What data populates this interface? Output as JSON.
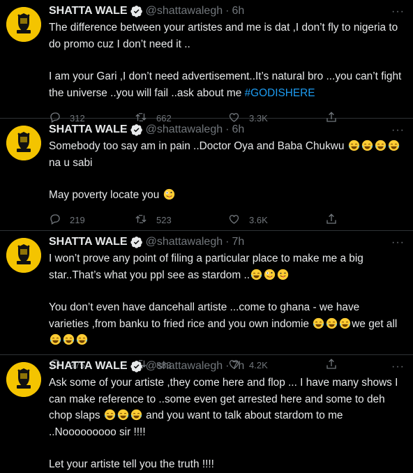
{
  "colors": {
    "background": "#000000",
    "text": "#e7e9ea",
    "muted": "#71767b",
    "link": "#1d9bf0",
    "verified": "#e7e9ea",
    "avatar": "#f4c400"
  },
  "tweets": [
    {
      "name": "SHATTA WALE",
      "handle": "@shattawalegh",
      "time": "6h",
      "paragraphs": [
        {
          "text": "The difference between your artistes and me is dat ,I don’t fly to nigeria to do promo cuz I don’t need it .."
        },
        {
          "text": "I am your Gari ,I don’t need advertisement..It’s natural bro ...you can’t fight the universe ..you will fail ..ask about me ",
          "hashtag": "#GODISHERE"
        }
      ],
      "stats": {
        "replies": "312",
        "retweets": "662",
        "likes": "3.3K"
      }
    },
    {
      "name": "SHATTA WALE",
      "handle": "@shattawalegh",
      "time": "6h",
      "paragraphs": [
        {
          "text": "Somebody too say am in pain ..Doctor Oya and Baba Chukwu",
          "emojis_after": [
            "tears-of-joy",
            "tears-of-joy",
            "tears-of-joy",
            "tears-of-joy"
          ],
          "text2": " na u sabi"
        },
        {
          "text": "May poverty locate  you",
          "emojis_after": [
            "zany-face"
          ]
        }
      ],
      "stats": {
        "replies": "219",
        "retweets": "523",
        "likes": "3.6K"
      }
    },
    {
      "name": "SHATTA WALE",
      "handle": "@shattawalegh",
      "time": "7h",
      "paragraphs": [
        {
          "text": "I won’t prove any point of filing a particular place to make me a big star..That’s what you ppl see as stardom ..",
          "emojis_after": [
            "tears-of-joy",
            "zany-face",
            "winking-tongue-face"
          ]
        },
        {
          "text": "You don’t even have dancehall artiste ...come to ghana - we have varieties ,from banku to fried rice and you own indomie",
          "emojis_after": [
            "tears-of-joy",
            "tears-of-joy",
            "tears-of-joy"
          ],
          "text2": "we get all",
          "emojis_after2": [
            "tears-of-joy",
            "tears-of-joy",
            "tears-of-joy"
          ]
        }
      ],
      "stats": {
        "replies": "375",
        "retweets": "883",
        "likes": "4.2K"
      }
    },
    {
      "name": "SHATTA WALE",
      "handle": "@shattawalegh",
      "time": "7h",
      "paragraphs": [
        {
          "text": "Ask some of your artiste ,they come here and flop ... I have many shows I can make reference to ..some even get arrested here and some to deh chop slaps",
          "emojis_after": [
            "tears-of-joy",
            "tears-of-joy",
            "tears-of-joy"
          ],
          "text2": " and you want to talk about stardom to me ..Nooooooooo sir !!!!"
        },
        {
          "text": "Let your artiste  tell you the truth !!!!"
        }
      ],
      "stats": {
        "replies": "",
        "retweets": "",
        "likes": ""
      }
    }
  ],
  "ui": {
    "dot": "·",
    "more": "···"
  },
  "icons": [
    "avatar-icon",
    "verified-icon",
    "more-icon",
    "reply-icon",
    "retweet-icon",
    "like-icon",
    "share-icon"
  ]
}
